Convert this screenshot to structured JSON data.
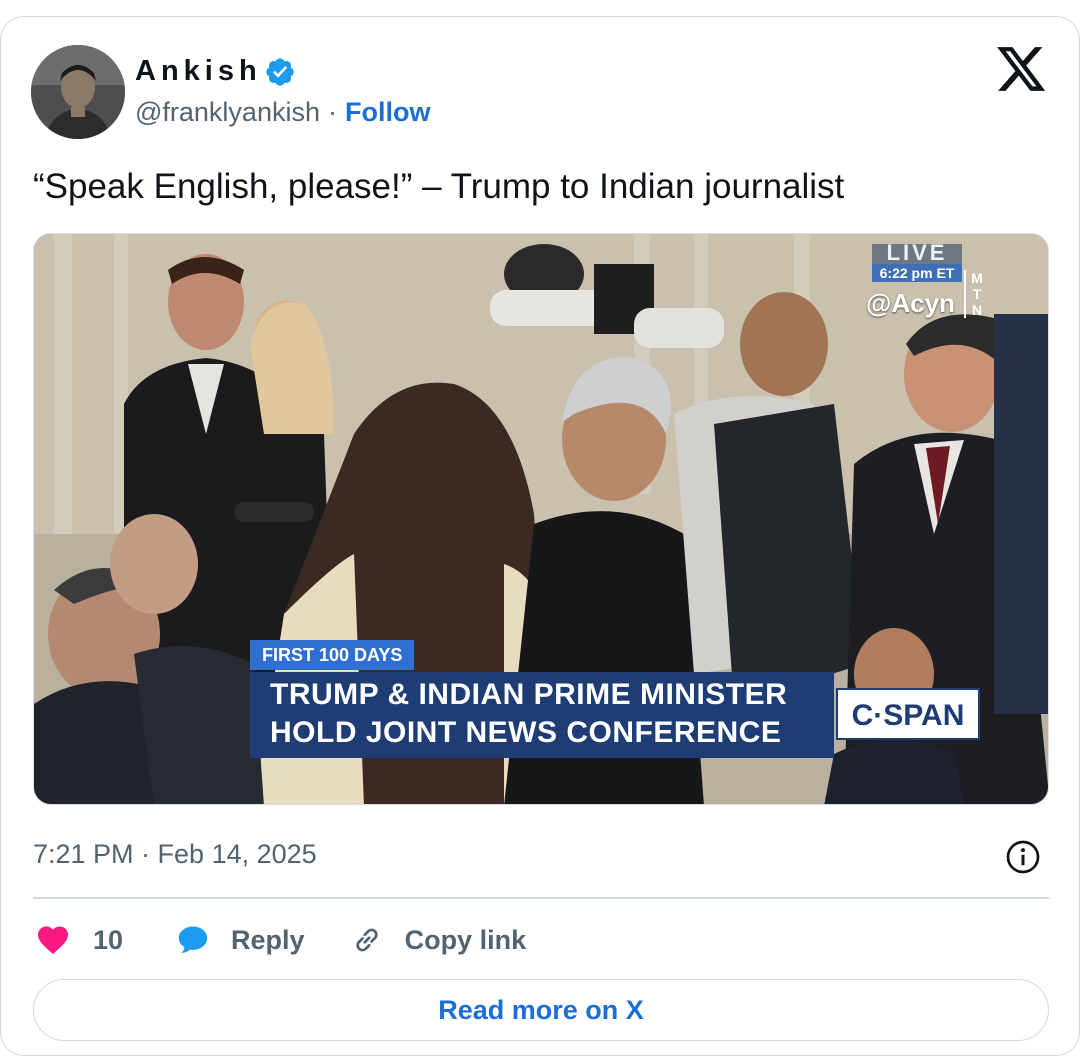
{
  "author": {
    "name": "Ankish",
    "handle": "@franklyankish",
    "separator": "·",
    "follow_label": "Follow",
    "verified_icon": "verified-badge-icon",
    "verified_color": "#1d9bf0"
  },
  "brand_icon": "x-logo-icon",
  "tweet": {
    "text": "“Speak English, please!” – Trump to Indian journalist"
  },
  "media": {
    "live_label": "LIVE",
    "live_time": "6:22 pm ET",
    "watermark": "@Acyn",
    "watermark_mark": [
      "M",
      "T",
      "N"
    ],
    "chyron_tag": "FIRST 100 DAYS",
    "chyron_line1": "TRUMP & INDIAN PRIME MINISTER",
    "chyron_line2": "HOLD JOINT NEWS CONFERENCE",
    "network": "C·SPAN"
  },
  "timestamp": "7:21 PM · Feb 14, 2025",
  "actions": {
    "like_count": "10",
    "reply_label": "Reply",
    "copy_label": "Copy link"
  },
  "read_more_label": "Read more on X",
  "colors": {
    "accent": "#1d6fd8",
    "like": "#f91880",
    "reply_icon": "#1d9bf0",
    "muted_text": "#536471",
    "border": "#cfd9de",
    "chyron_bg": "#1e3d74",
    "chyron_tag_bg": "#2f6fd1"
  }
}
